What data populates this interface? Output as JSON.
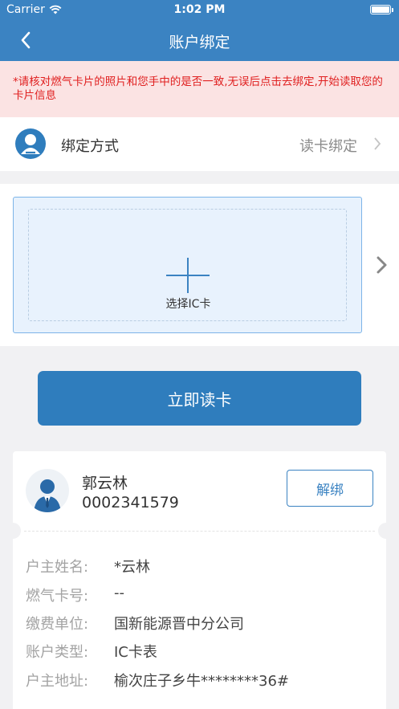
{
  "status_bar": {
    "carrier": "Carrier",
    "time": "1:02 PM"
  },
  "nav": {
    "title": "账户绑定"
  },
  "notice": {
    "text": "*请核对燃气卡片的照片和您手中的是否一致,无误后点击去绑定,开始读取您的卡片信息"
  },
  "bind_method": {
    "label": "绑定方式",
    "value": "读卡绑定"
  },
  "card_select": {
    "label": "选择IC卡"
  },
  "read_button": {
    "label": "立即读卡"
  },
  "account": {
    "name": "郭云林",
    "number": "0002341579",
    "unbind_label": "解绑",
    "fields": [
      {
        "label": "户主姓名:",
        "value": "*云林"
      },
      {
        "label": "燃气卡号:",
        "value": "--"
      },
      {
        "label": "缴费单位:",
        "value": "国新能源晋中分公司"
      },
      {
        "label": "账户类型:",
        "value": "IC卡表"
      },
      {
        "label": "户主地址:",
        "value": "榆次庄子乡牛********36#"
      }
    ]
  },
  "colors": {
    "primary": "#3b83c2",
    "button": "#2f7dbd",
    "notice_bg": "#fbe3e3",
    "notice_text": "#e02020"
  },
  "icons": [
    "wifi-icon",
    "battery-icon",
    "back-arrow-icon",
    "user-icon",
    "chevron-right-icon",
    "plus-icon",
    "avatar-icon"
  ]
}
